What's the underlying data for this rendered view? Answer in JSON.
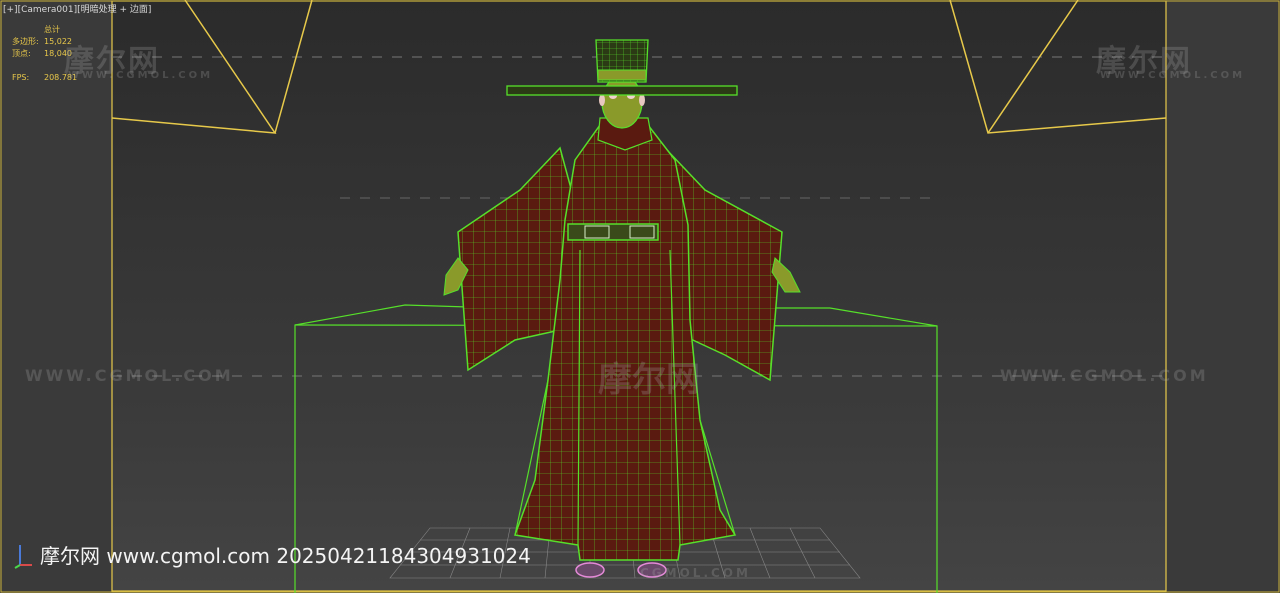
{
  "viewport": {
    "label_parts": [
      "[+]",
      "[Camera001]",
      "[明暗处理 + 边面]"
    ]
  },
  "stats": {
    "header": "总计",
    "rows": [
      {
        "label": "多边形:",
        "value": "15,022"
      },
      {
        "label": "顶点:",
        "value": "18,040"
      }
    ],
    "fps_label": "FPS:",
    "fps_value": "208.781"
  },
  "watermarks": {
    "logo": "摩尔网",
    "url": "WWW.CGMOL.COM",
    "center_logo": "摩尔网",
    "center_url": "CGMOL.COM"
  },
  "footer": {
    "text": "摩尔网 www.cgmol.com 20250421184304931024"
  },
  "colors": {
    "wire": "#56e02a",
    "robe": "#5a1a10",
    "camera_frame": "#e7c94a",
    "skin": "#8a9a2a",
    "shoe": "#e58ad8"
  }
}
